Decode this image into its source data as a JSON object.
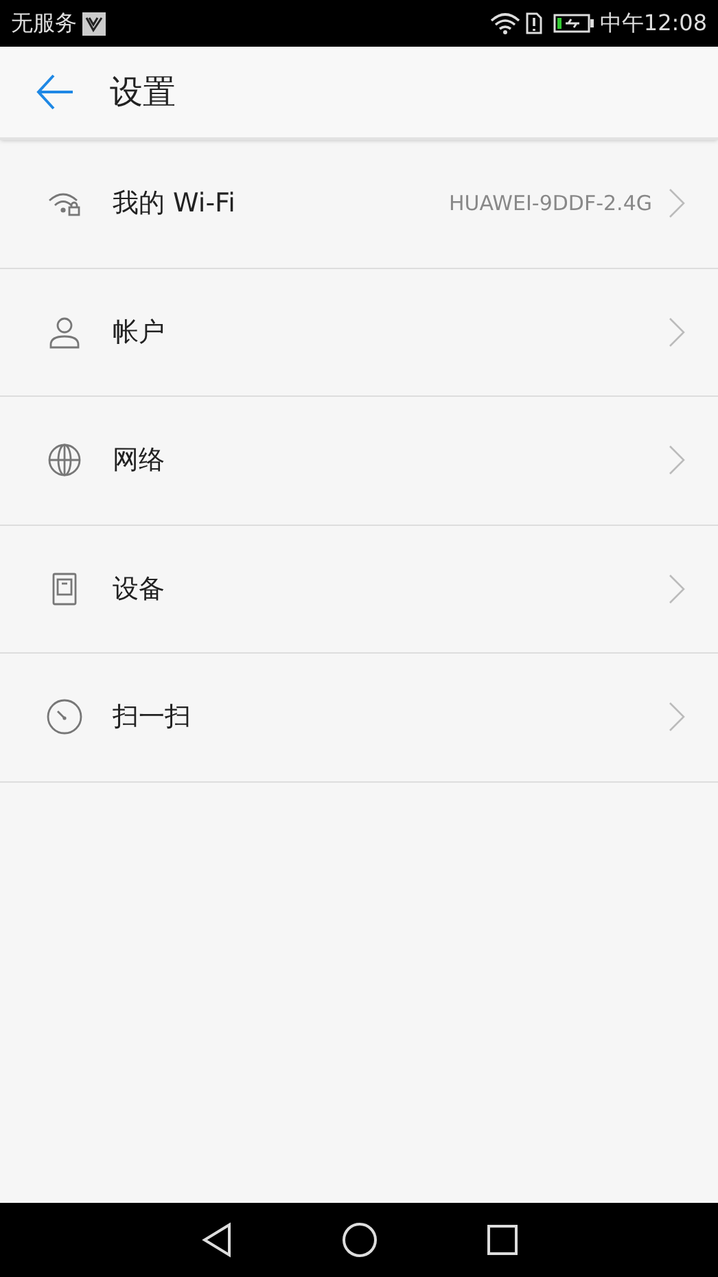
{
  "status_bar": {
    "carrier": "无服务",
    "time": "中午12:08"
  },
  "header": {
    "title": "设置"
  },
  "items": [
    {
      "kind": "wifi",
      "label": "我的 Wi-Fi",
      "value": "HUAWEI-9DDF-2.4G"
    },
    {
      "kind": "account",
      "label": "帐户"
    },
    {
      "kind": "network",
      "label": "网络"
    },
    {
      "kind": "device",
      "label": "设备"
    },
    {
      "kind": "scan",
      "label": "扫一扫"
    }
  ]
}
